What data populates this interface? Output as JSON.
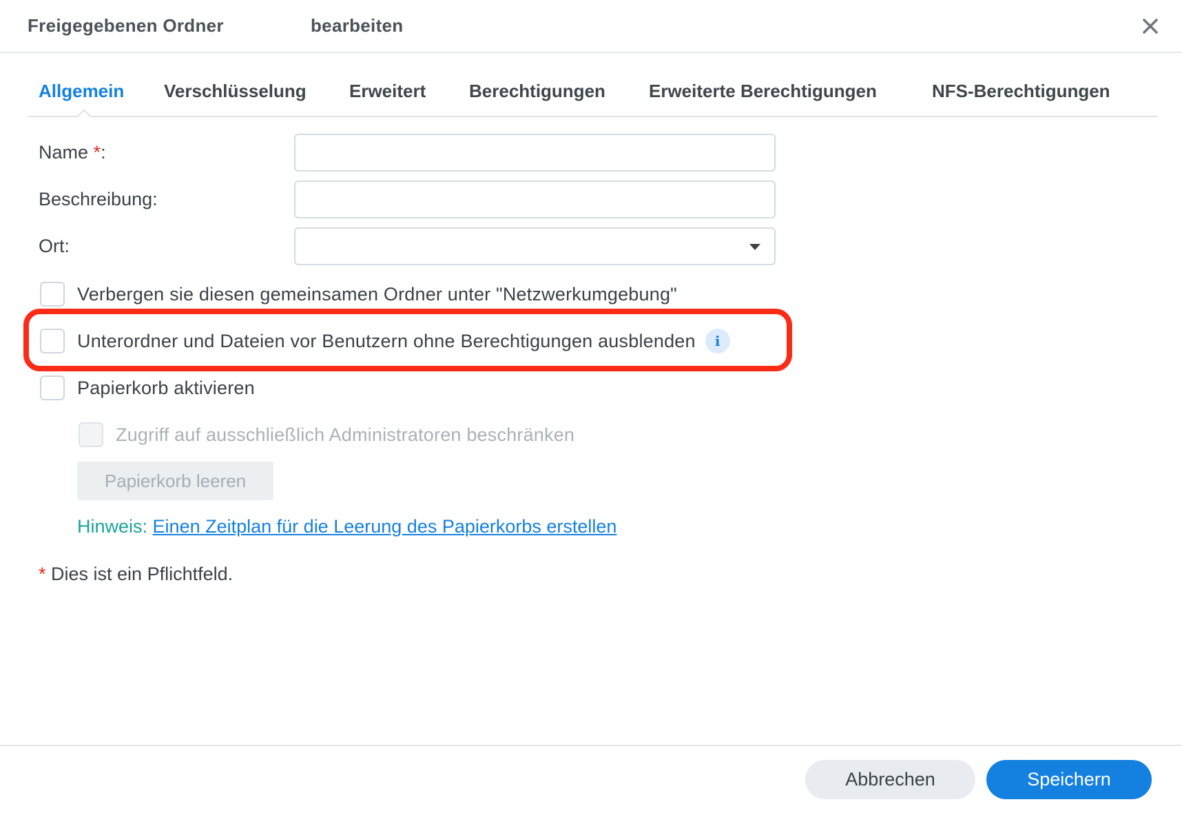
{
  "titlebar": {
    "title_part1": "Freigegebenen Ordner",
    "title_part2": "bearbeiten"
  },
  "tabs": [
    {
      "label": "Allgemein",
      "active": true
    },
    {
      "label": "Verschlüsselung",
      "active": false
    },
    {
      "label": "Erweitert",
      "active": false
    },
    {
      "label": "Berechtigungen",
      "active": false
    },
    {
      "label": "Erweiterte Berechtigungen",
      "active": false
    },
    {
      "label": "NFS-Berechtigungen",
      "active": false
    }
  ],
  "form": {
    "name_label": "Name",
    "required_marker": "*",
    "colon": ":",
    "name_value": "",
    "description_label": "Beschreibung:",
    "description_value": "",
    "location_label": "Ort:",
    "location_value": ""
  },
  "checkboxes": {
    "hide_network": {
      "label": "Verbergen sie diesen gemeinsamen Ordner unter \"Netzwerkumgebung\"",
      "checked": false
    },
    "hide_subfolders": {
      "label": "Unterordner und Dateien vor Benutzern ohne Berechtigungen ausblenden",
      "checked": false,
      "info_icon": "i"
    },
    "recycle_bin": {
      "label": "Papierkorb aktivieren",
      "checked": false
    },
    "admin_only": {
      "label": "Zugriff auf ausschließlich Administratoren beschränken",
      "checked": false,
      "disabled": true
    }
  },
  "empty_recycle_button": "Papierkorb leeren",
  "hint": {
    "label": "Hinweis:",
    "link": "Einen Zeitplan für die Leerung des Papierkorbs erstellen"
  },
  "footnote": {
    "marker": "*",
    "text": " Dies ist ein Pflichtfeld."
  },
  "footer": {
    "cancel_label": "Abbrechen",
    "save_label": "Speichern"
  },
  "colors": {
    "accent": "#1480e0",
    "highlight": "#fb2c16",
    "hint": "#1aa39a",
    "required": "#e02a1f"
  },
  "icons": {
    "close": "close-icon",
    "dropdown": "chevron-down-icon",
    "info": "info-icon"
  }
}
